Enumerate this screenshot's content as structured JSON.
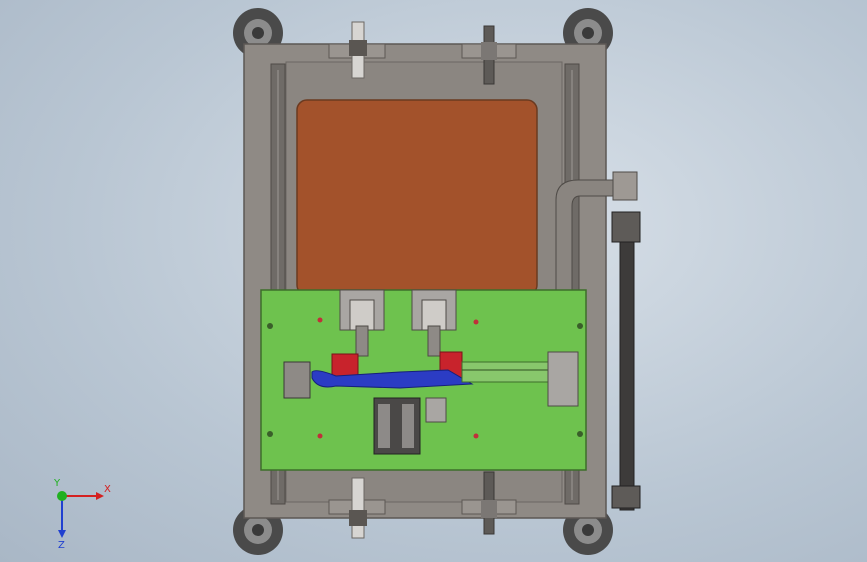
{
  "viewport": {
    "background": "#c3cdd8"
  },
  "colors": {
    "frame": "#8f8a85",
    "frame_edge": "#5c5854",
    "rail": "#6f6b67",
    "pad": "#a3522b",
    "pad_edge": "#6b3a20",
    "plate": "#6ec24e",
    "plate_edge": "#3d6e2a",
    "red_block": "#c8232c",
    "blue_part": "#2b3cc4",
    "caster": "#4a4a4a",
    "caster_light": "#8c8c8c"
  },
  "triad": {
    "x_label": "X",
    "y_label": "Y",
    "z_label": "Z",
    "x_color": "#d42020",
    "y_color": "#20b020",
    "z_color": "#2040d0"
  }
}
